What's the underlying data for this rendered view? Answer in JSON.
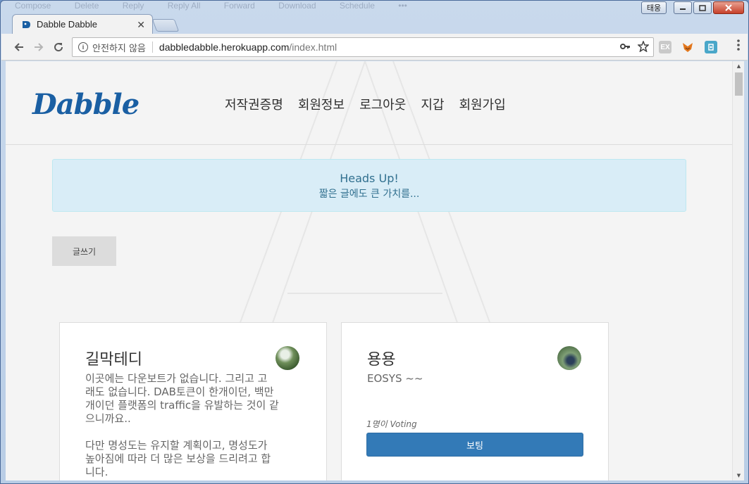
{
  "background_menu": [
    "Compose",
    "Delete",
    "Reply",
    "Reply All",
    "Forward",
    "Download",
    "Schedule",
    "•••"
  ],
  "window": {
    "user_badge": "태웅"
  },
  "tab": {
    "title": "Dabble Dabble"
  },
  "address_bar": {
    "security_text": "안전하지 않음",
    "url_host": "dabbledabble.herokuapp.com",
    "url_path": "/index.html"
  },
  "site": {
    "logo": "Dabble",
    "nav": [
      "저작권증명",
      "회원정보",
      "로그아웃",
      "지갑",
      "회원가입"
    ]
  },
  "alert": {
    "title": "Heads Up!",
    "body": "짧은 글에도 큰 가치를..."
  },
  "write_button": "글쓰기",
  "cards": [
    {
      "title": "길막테디",
      "body": "이곳에는 다운보트가 없습니다. 그리고 고\n래도 없습니다. DAB토큰이 한개이던, 백만\n개이던 플랫폼의 traffic을 유발하는 것이 같\n으니까요..\n\n다만 명성도는 유지할 계획이고, 명성도가\n높아짐에 따라 더 많은 보상을 드리려고 합\n니다."
    },
    {
      "title": "용용",
      "body": "EOSYS ~~",
      "voting_text": "1명이 Voting",
      "vote_button": "보팅"
    }
  ],
  "colors": {
    "brand": "#1a5fa3",
    "alert_bg": "#d9edf7",
    "primary_button": "#337ab7"
  }
}
